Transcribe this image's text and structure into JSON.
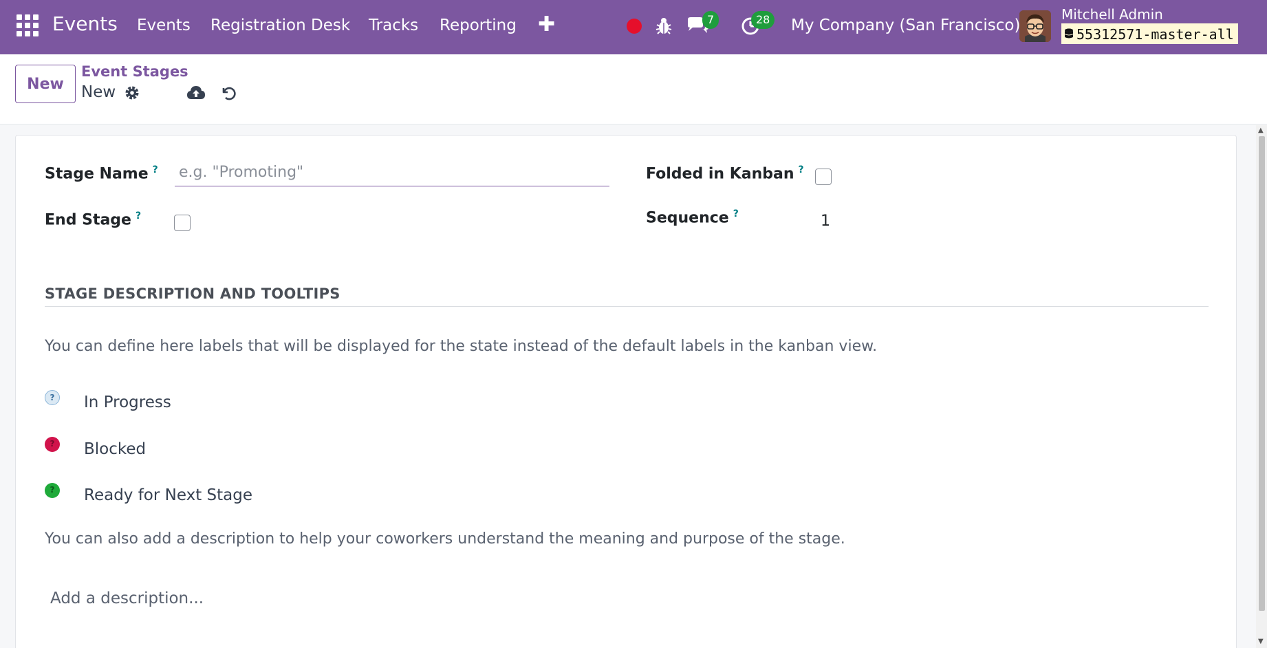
{
  "navbar": {
    "brand": "Events",
    "menu": [
      "Events",
      "Registration Desk",
      "Tracks",
      "Reporting"
    ],
    "chat_badge": "7",
    "activity_badge": "28",
    "company": "My Company (San Francisco)",
    "user_name": "Mitchell Admin",
    "db_name": "55312571-master-all",
    "accent_color": "#7c57a0"
  },
  "control": {
    "new_label": "New",
    "breadcrumb": "Event Stages",
    "record_name": "New"
  },
  "form": {
    "stage_name_label": "Stage Name",
    "stage_name_placeholder": "e.g. \"Promoting\"",
    "stage_name_value": "",
    "help_mark": "?",
    "end_stage_label": "End Stage",
    "end_stage_checked": false,
    "folded_label": "Folded in Kanban",
    "folded_checked": false,
    "sequence_label": "Sequence",
    "sequence_value": "1",
    "section_title": "STAGE DESCRIPTION AND TOOLTIPS",
    "intro_text": "You can define here labels that will be displayed for the state instead of the default labels in the kanban view.",
    "states": [
      {
        "label": "In Progress",
        "color": "#dbe9f4"
      },
      {
        "label": "Blocked",
        "color": "#d1134b"
      },
      {
        "label": "Ready for Next Stage",
        "color": "#1faa3a"
      }
    ],
    "outro_text": "You can also add a description to help your coworkers understand the meaning and purpose of the stage.",
    "description_placeholder": "Add a description..."
  }
}
